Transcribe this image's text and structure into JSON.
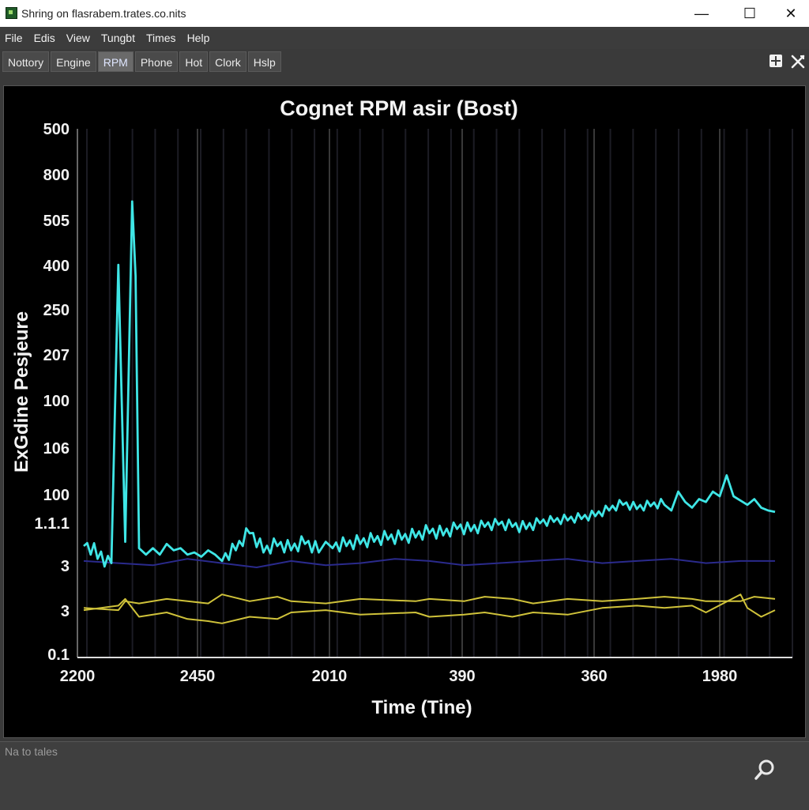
{
  "window": {
    "title": "Shring on flasrabem.trates.co.nits",
    "minimize_glyph": "—",
    "maximize_glyph": "☐",
    "close_glyph": "✕"
  },
  "menu": [
    "File",
    "Edis",
    "View",
    "Tungbt",
    "Times",
    "Help"
  ],
  "tabs": [
    {
      "label": "Nottory",
      "active": false
    },
    {
      "label": "Engine",
      "active": false
    },
    {
      "label": "RPM",
      "active": true
    },
    {
      "label": "Phone",
      "active": false
    },
    {
      "label": "Hot",
      "active": false
    },
    {
      "label": "Clork",
      "active": false
    },
    {
      "label": "Hslp",
      "active": false
    }
  ],
  "toolbar_icons": [
    "grid-icon",
    "tools-icon"
  ],
  "status": {
    "text": "Na to tales",
    "icon": "search-icon"
  },
  "chart_data": {
    "type": "line",
    "title": "Cognet RPM asir (Bost)",
    "xlabel": "Time (Tine)",
    "ylabel": "ExGdine Pesjeure",
    "yticks": [
      "500",
      "800",
      "505",
      "400",
      "250",
      "207",
      "100",
      "106",
      "100",
      "1.1.1",
      "3",
      "3",
      "0.1"
    ],
    "xticks": [
      "2200",
      "2450",
      "2010",
      "390",
      "360",
      "1980"
    ],
    "grid": true,
    "colors": {
      "cyan": "#3fe6e6",
      "yellow": "#cfc23a",
      "navy": "#2a2a8c",
      "grid": "#4a4a4a"
    },
    "series": [
      {
        "color": "#3fe6e6",
        "x": [
          0,
          4,
          5,
          6,
          7,
          7.5,
          8,
          9,
          10,
          11,
          12,
          13,
          14,
          15,
          16,
          17,
          18,
          19,
          20,
          22,
          24,
          26,
          28,
          30,
          32,
          34,
          35,
          36,
          38,
          40,
          42,
          44,
          46,
          48,
          50,
          52,
          54,
          56,
          58,
          60,
          62,
          64,
          66,
          68,
          70,
          72,
          74,
          76,
          78,
          80,
          82,
          84,
          85,
          86,
          87,
          88,
          89,
          90,
          91,
          92,
          93,
          94,
          95,
          96,
          97,
          98,
          99,
          100
        ],
        "y": [
          9.5,
          9.9,
          2.95,
          9.4,
          1.55,
          3.2,
          9.55,
          9.7,
          9.55,
          9.7,
          9.45,
          9.6,
          9.55,
          9.7,
          9.65,
          9.75,
          9.6,
          9.7,
          9.85,
          9.6,
          9.2,
          9.65,
          9.5,
          9.6,
          9.45,
          9.65,
          9.4,
          9.55,
          9.5,
          9.45,
          9.4,
          9.35,
          9.35,
          9.3,
          9.2,
          9.25,
          9.1,
          9.15,
          9.05,
          9.0,
          9.05,
          9.1,
          8.95,
          8.9,
          8.85,
          8.8,
          8.7,
          8.5,
          8.3,
          8.45,
          8.35,
          8.3,
          8.5,
          7.9,
          8.2,
          8.4,
          8.1,
          8.2,
          7.9,
          8.0,
          7.55,
          8.0,
          8.15,
          8.3,
          8.1,
          8.4,
          8.5,
          8.55
        ]
      },
      {
        "color": "#cfc23a",
        "x": [
          0,
          5,
          6,
          8,
          12,
          15,
          18,
          20,
          24,
          28,
          30,
          35,
          40,
          48,
          50,
          55,
          58,
          62,
          65,
          70,
          75,
          80,
          84,
          88,
          90,
          95,
          97,
          100
        ],
        "y": [
          10.9,
          10.95,
          10.75,
          10.8,
          10.7,
          10.75,
          10.8,
          10.6,
          10.75,
          10.65,
          10.75,
          10.8,
          10.7,
          10.75,
          10.7,
          10.75,
          10.65,
          10.7,
          10.8,
          10.7,
          10.75,
          10.7,
          10.65,
          10.7,
          10.75,
          10.75,
          10.65,
          10.7
        ]
      },
      {
        "color": "#cfc23a",
        "x": [
          0,
          5,
          6,
          8,
          12,
          15,
          18,
          20,
          24,
          28,
          30,
          35,
          40,
          48,
          50,
          55,
          58,
          62,
          65,
          70,
          75,
          80,
          84,
          88,
          90,
          95,
          96,
          98,
          100
        ],
        "y": [
          10.95,
          10.85,
          10.7,
          11.1,
          11.0,
          11.15,
          11.2,
          11.25,
          11.1,
          11.15,
          11.0,
          10.95,
          11.05,
          11.0,
          11.1,
          11.05,
          11.0,
          11.1,
          11.0,
          11.05,
          10.9,
          10.85,
          10.9,
          10.85,
          11.0,
          10.6,
          10.9,
          11.1,
          10.95
        ]
      },
      {
        "color": "#2a2a8c",
        "x": [
          0,
          5,
          10,
          15,
          20,
          25,
          30,
          35,
          40,
          45,
          50,
          55,
          60,
          65,
          70,
          75,
          80,
          85,
          90,
          95,
          100
        ],
        "y": [
          9.85,
          9.9,
          9.95,
          9.8,
          9.9,
          10.0,
          9.85,
          9.95,
          9.9,
          9.8,
          9.85,
          9.95,
          9.9,
          9.85,
          9.8,
          9.9,
          9.85,
          9.8,
          9.9,
          9.85,
          9.85
        ]
      }
    ]
  }
}
